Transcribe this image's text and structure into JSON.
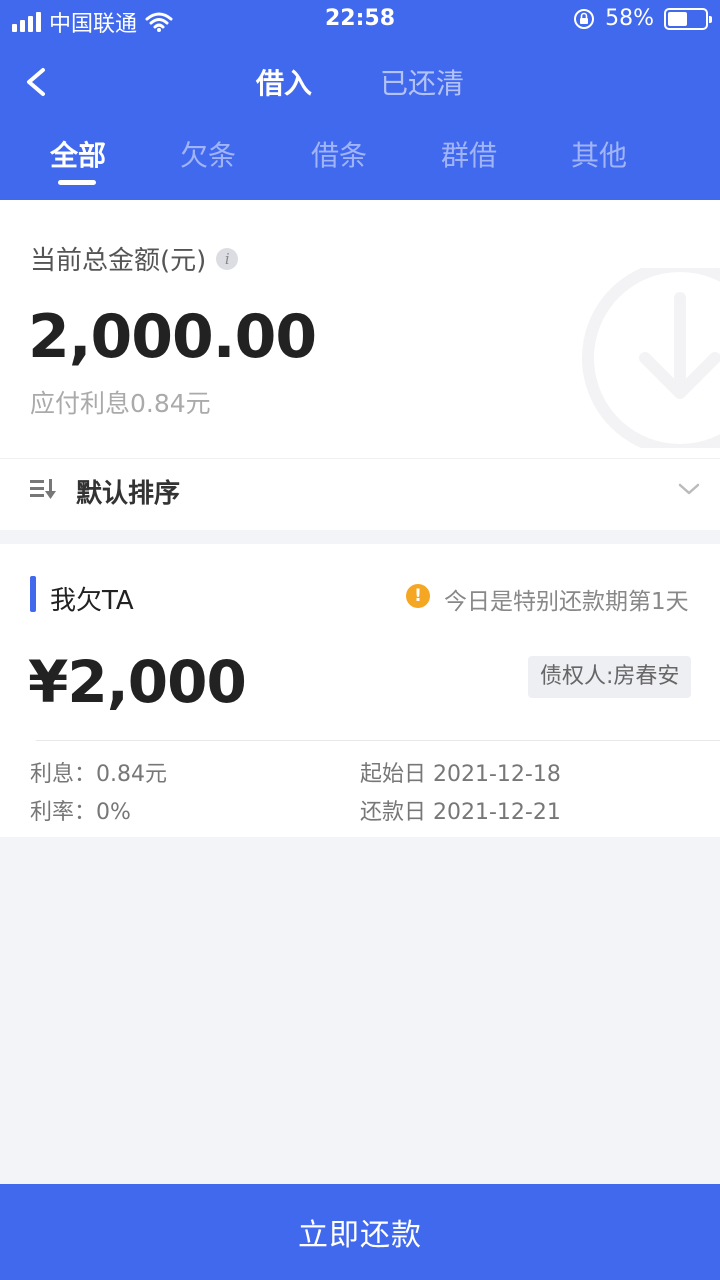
{
  "status_bar": {
    "carrier": "中国联通",
    "time": "22:58",
    "battery": "58%",
    "battery_level": 0.58
  },
  "nav": {
    "tabs": [
      {
        "label": "借入",
        "active": true
      },
      {
        "label": "已还清",
        "active": false
      }
    ]
  },
  "sub_tabs": [
    {
      "label": "全部",
      "active": true
    },
    {
      "label": "欠条",
      "active": false
    },
    {
      "label": "借条",
      "active": false
    },
    {
      "label": "群借",
      "active": false
    },
    {
      "label": "其他",
      "active": false
    }
  ],
  "summary": {
    "label": "当前总金额(元)",
    "info_icon": "i",
    "amount": "2,000.00",
    "interest": "应付利息0.84元",
    "sort_label": "默认排序"
  },
  "loan": {
    "title": "我欠TA",
    "warning": "今日是特别还款期第1天",
    "warning_icon": "!",
    "amount": "¥2,000",
    "creditor": "债权人:房春安",
    "interest": "利息：0.84元",
    "rate": "利率：0%",
    "start_date": "起始日 2021-12-18",
    "repay_date": "还款日 2021-12-21"
  },
  "pay_button": "立即还款",
  "colors": {
    "brand": "#4169ee",
    "warning": "#f5a623",
    "background": "#f3f4f8"
  }
}
